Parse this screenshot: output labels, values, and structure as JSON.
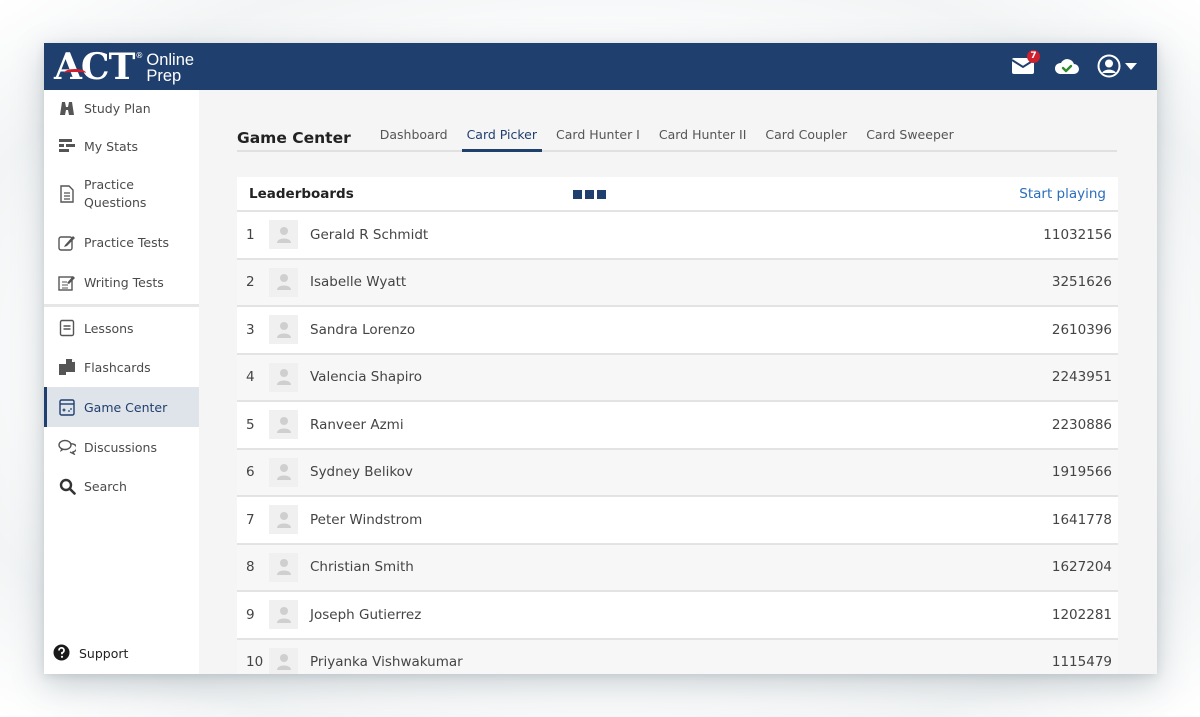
{
  "header": {
    "logo_main": "ACT",
    "logo_reg": "®",
    "logo_sub_line1": "Online",
    "logo_sub_line2": "Prep",
    "mail_badge": "7",
    "icons": [
      "mail-icon",
      "cloud-check-icon",
      "user-account-icon",
      "caret-down-icon"
    ],
    "colors": {
      "brand": "#1f3f6e",
      "badge": "#d0202e",
      "cloud_check": "#2e8b2e"
    }
  },
  "sidebar": {
    "items": [
      {
        "label": "Study Plan",
        "icon": "binoculars-icon"
      },
      {
        "label": "My Stats",
        "icon": "stats-bars-icon"
      },
      {
        "label": "Practice Questions",
        "icon": "document-list-icon"
      },
      {
        "label": "Practice Tests",
        "icon": "pencil-square-icon"
      },
      {
        "label": "Writing Tests",
        "icon": "writing-document-icon"
      },
      {
        "label": "Lessons",
        "icon": "lesson-book-icon"
      },
      {
        "label": "Flashcards",
        "icon": "flashcards-icon"
      },
      {
        "label": "Game Center",
        "icon": "game-controller-icon",
        "active": true
      },
      {
        "label": "Discussions",
        "icon": "chat-bubbles-icon"
      },
      {
        "label": "Search",
        "icon": "search-icon"
      }
    ],
    "support_label": "Support"
  },
  "main": {
    "page_title": "Game Center",
    "tabs": [
      {
        "label": "Dashboard"
      },
      {
        "label": "Card Picker",
        "active": true
      },
      {
        "label": "Card Hunter I"
      },
      {
        "label": "Card Hunter II"
      },
      {
        "label": "Card Coupler"
      },
      {
        "label": "Card Sweeper"
      }
    ],
    "leaderboard": {
      "title": "Leaderboards",
      "start_label": "Start playing",
      "rows": [
        {
          "rank": "1",
          "name": "Gerald R Schmidt",
          "score": "11032156"
        },
        {
          "rank": "2",
          "name": "Isabelle Wyatt",
          "score": "3251626"
        },
        {
          "rank": "3",
          "name": "Sandra Lorenzo",
          "score": "2610396"
        },
        {
          "rank": "4",
          "name": "Valencia Shapiro",
          "score": "2243951"
        },
        {
          "rank": "5",
          "name": "Ranveer Azmi",
          "score": "2230886"
        },
        {
          "rank": "6",
          "name": "Sydney Belikov",
          "score": "1919566"
        },
        {
          "rank": "7",
          "name": "Peter Windstrom",
          "score": "1641778"
        },
        {
          "rank": "8",
          "name": "Christian Smith",
          "score": "1627204"
        },
        {
          "rank": "9",
          "name": "Joseph Gutierrez",
          "score": "1202281"
        },
        {
          "rank": "10",
          "name": "Priyanka Vishwakumar",
          "score": "1115479"
        }
      ]
    }
  }
}
